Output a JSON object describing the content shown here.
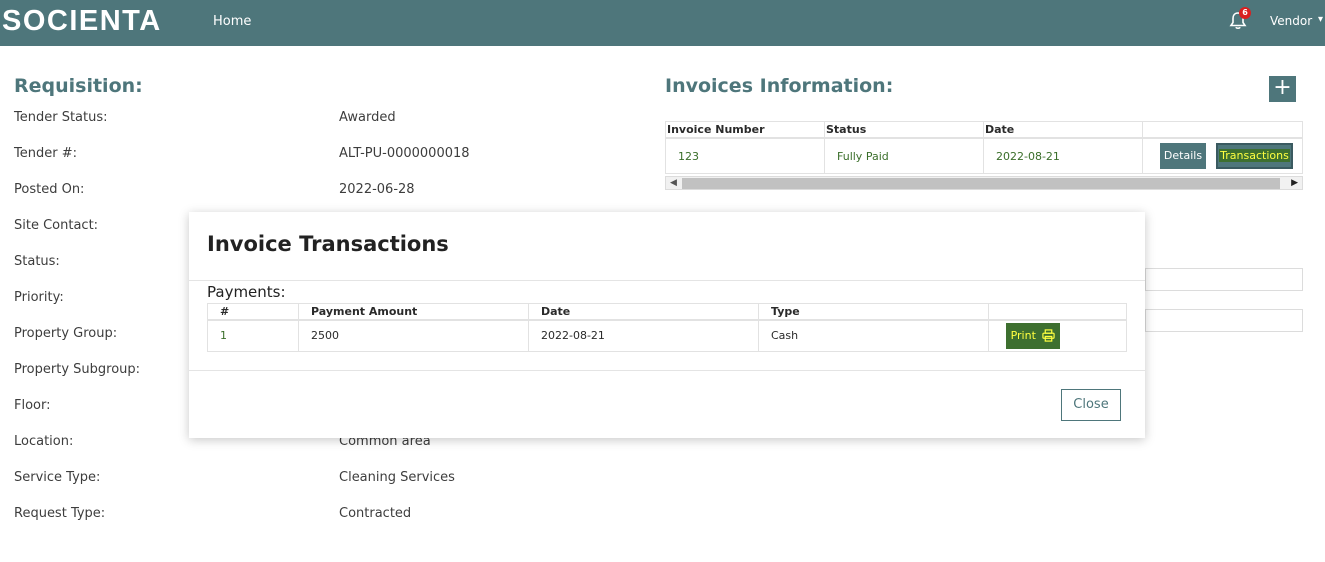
{
  "topbar": {
    "logo": "SOCIENTA",
    "nav_home": "Home",
    "notification_count": "6",
    "user_label": "Vendor",
    "caret": "▾"
  },
  "requisition": {
    "title": "Requisition:",
    "fields": [
      {
        "label": "Tender Status:",
        "value": "Awarded"
      },
      {
        "label": "Tender #:",
        "value": "ALT-PU-0000000018"
      },
      {
        "label": "Posted On:",
        "value": "2022-06-28"
      },
      {
        "label": "Site Contact:",
        "value": ""
      },
      {
        "label": "Status:",
        "value": ""
      },
      {
        "label": "Priority:",
        "value": ""
      },
      {
        "label": "Property Group:",
        "value": ""
      },
      {
        "label": "Property Subgroup:",
        "value": ""
      },
      {
        "label": "Floor:",
        "value": ""
      },
      {
        "label": "Location:",
        "value": "Common area"
      },
      {
        "label": "Service Type:",
        "value": "Cleaning Services"
      },
      {
        "label": "Request Type:",
        "value": "Contracted"
      }
    ]
  },
  "invoices": {
    "title": "Invoices Information:",
    "add_label": "+",
    "headers": [
      "Invoice Number",
      "Status",
      "Date",
      ""
    ],
    "row": {
      "number": "123",
      "status": "Fully Paid",
      "date": "2022-08-21"
    },
    "details_label": "Details",
    "transactions_label": "Transactions",
    "scroll_left": "◀",
    "scroll_right": "▶"
  },
  "modal": {
    "title": "Invoice Transactions",
    "payments_label": "Payments:",
    "headers": [
      "#",
      "Payment Amount",
      "Date",
      "Type",
      ""
    ],
    "row": {
      "index": "1",
      "amount": "2500",
      "date": "2022-08-21",
      "type": "Cash"
    },
    "print_label": "Print",
    "close_label": "Close"
  },
  "colors": {
    "brand": "#4e767b",
    "highlight_bg": "#3d6f2f",
    "highlight_text": "#ffff40",
    "badge": "#d92020"
  }
}
